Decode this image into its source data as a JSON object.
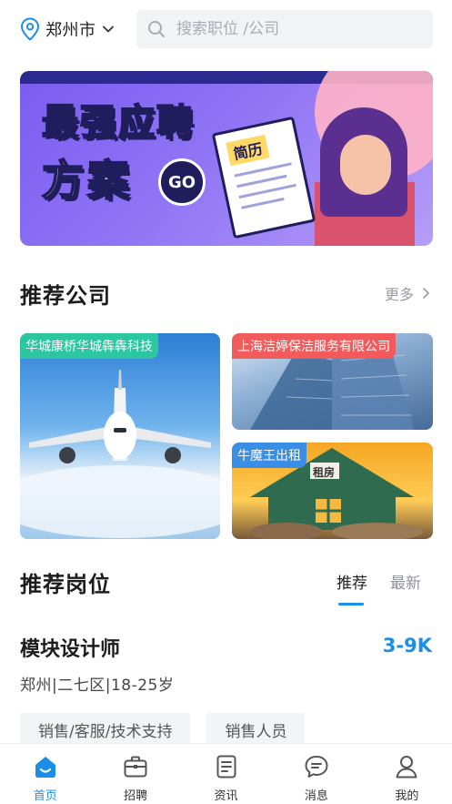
{
  "header": {
    "city": "郑州市",
    "search_placeholder": "搜索职位 /公司"
  },
  "banner": {
    "title_line1": "最强应聘",
    "title_line2": "方案",
    "go_label": "GO",
    "resume_label": "简历"
  },
  "companies": {
    "title": "推荐公司",
    "more_label": "更多",
    "items": [
      {
        "name": "华城康桥华城犇犇科技",
        "tag_color": "#2cc6a0"
      },
      {
        "name": "上海洁婷保洁服务有限公司",
        "tag_color": "#f25b5b"
      },
      {
        "name": "牛魔王出租",
        "tag_color": "#3a8ee6"
      }
    ],
    "rent_sign": "租房"
  },
  "jobs": {
    "title": "推荐岗位",
    "tabs": [
      "推荐",
      "最新"
    ],
    "active_tab": 0,
    "list": [
      {
        "title": "模块设计师",
        "salary": "3-9K",
        "meta": "郑州|二七区|18-25岁",
        "tags": [
          "销售/客服/技术支持",
          "销售人员"
        ]
      }
    ]
  },
  "bottom_nav": {
    "items": [
      {
        "label": "首页",
        "icon": "home-icon",
        "active": true
      },
      {
        "label": "招聘",
        "icon": "briefcase-icon",
        "active": false
      },
      {
        "label": "资讯",
        "icon": "news-icon",
        "active": false
      },
      {
        "label": "消息",
        "icon": "message-icon",
        "active": false
      },
      {
        "label": "我的",
        "icon": "profile-icon",
        "active": false
      }
    ]
  },
  "colors": {
    "accent": "#1a8fe8",
    "text_primary": "#1c1c1c",
    "text_muted": "#9a9da3"
  }
}
